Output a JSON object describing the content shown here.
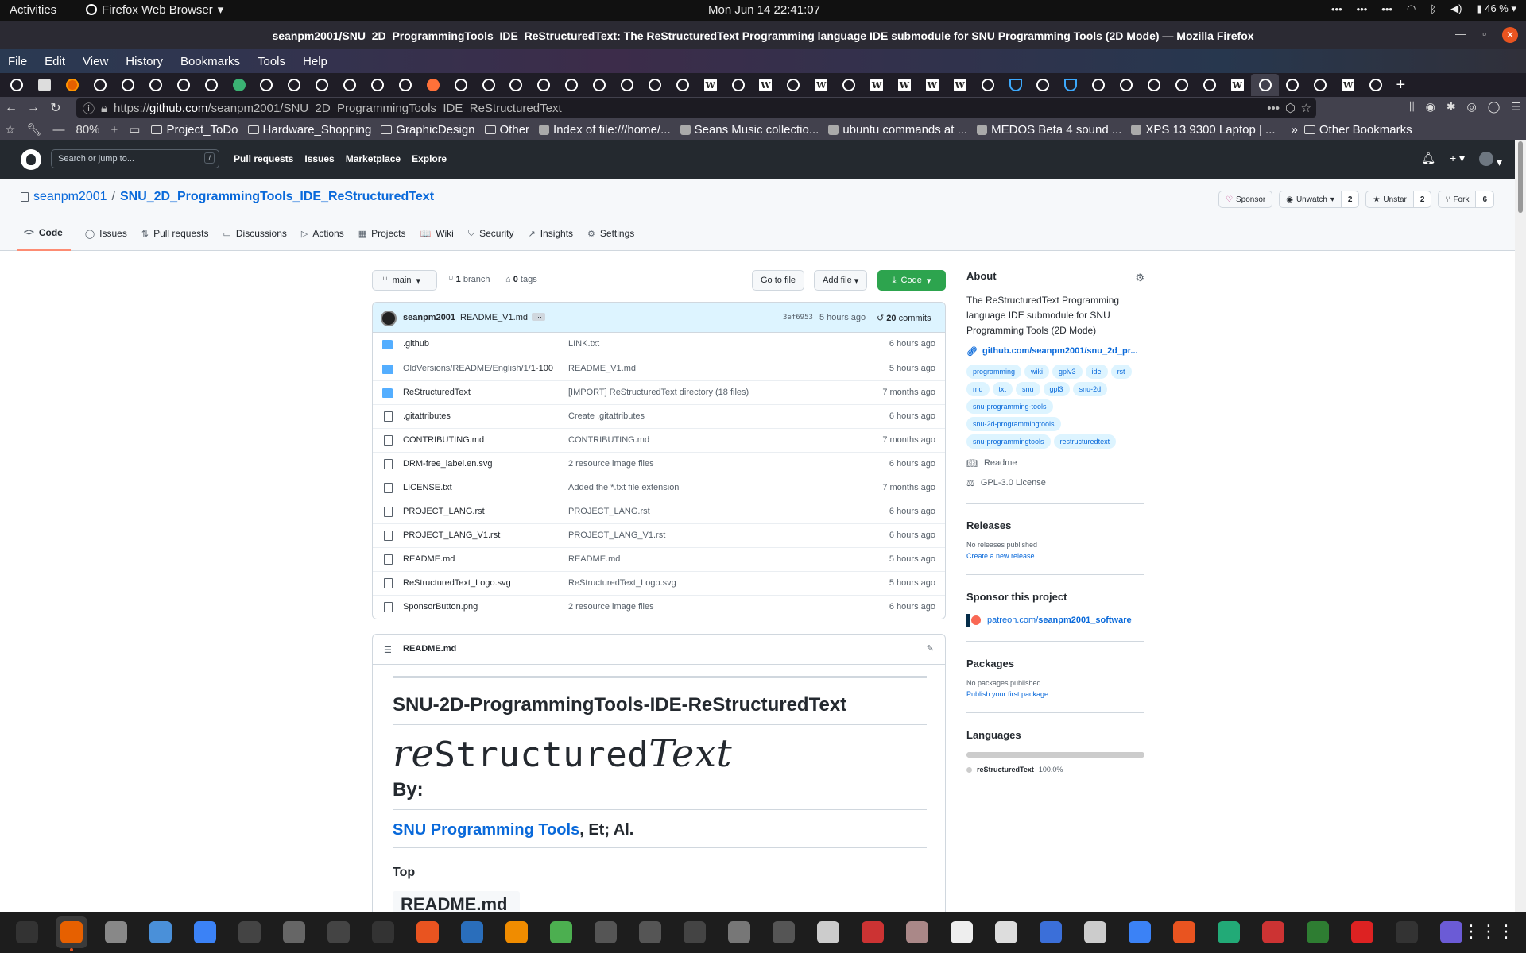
{
  "gnome": {
    "activities": "Activities",
    "app_menu": "Firefox Web Browser",
    "clock": "Mon Jun 14  22:41:07",
    "battery": "46 %"
  },
  "window": {
    "title": "seanpm2001/SNU_2D_ProgrammingTools_IDE_ReStructuredText: The ReStructuredText Programming language IDE submodule for SNU Programming Tools (2D Mode) — Mozilla Firefox"
  },
  "menubar": [
    "File",
    "Edit",
    "View",
    "History",
    "Bookmarks",
    "Tools",
    "Help"
  ],
  "tabs": [
    "gh",
    "puzzle",
    "firefox",
    "gh",
    "gh",
    "gh",
    "gh",
    "gh",
    "green",
    "gh",
    "gh",
    "gh",
    "gh",
    "gh",
    "gh",
    "orange",
    "gh",
    "gh",
    "gh",
    "gh",
    "gh",
    "gh",
    "gh",
    "gh",
    "gh",
    "w",
    "gh",
    "w",
    "gh",
    "w",
    "gh",
    "w",
    "w",
    "w",
    "w",
    "gh",
    "mw",
    "gh",
    "mw",
    "gh",
    "gh",
    "gh",
    "gh",
    "gh",
    "w",
    "gh-active",
    "gh",
    "gh",
    "w",
    "gh"
  ],
  "url": {
    "prefix": "https://",
    "host": "github.com",
    "path": "/seanpm2001/SNU_2D_ProgrammingTools_IDE_ReStructuredText"
  },
  "bookmarks": {
    "zoom": "80%",
    "items": [
      {
        "label": "Project_ToDo",
        "type": "folder"
      },
      {
        "label": "Hardware_Shopping",
        "type": "folder"
      },
      {
        "label": "GraphicDesign",
        "type": "folder"
      },
      {
        "label": "Other",
        "type": "folder"
      },
      {
        "label": "Index of file:///home/...",
        "type": "page"
      },
      {
        "label": "Seans Music collectio...",
        "type": "page"
      },
      {
        "label": "ubuntu commands at ...",
        "type": "page"
      },
      {
        "label": "MEDOS Beta 4 sound ...",
        "type": "page"
      },
      {
        "label": "XPS 13 9300 Laptop | ...",
        "type": "page"
      }
    ],
    "other": "Other Bookmarks"
  },
  "gh_header": {
    "search_placeholder": "Search or jump to...",
    "slash": "/",
    "nav": [
      "Pull requests",
      "Issues",
      "Marketplace",
      "Explore"
    ]
  },
  "repo": {
    "owner": "seanpm2001",
    "separator": "/",
    "name": "SNU_2D_ProgrammingTools_IDE_ReStructuredText",
    "sponsor": "Sponsor",
    "unwatch": "Unwatch",
    "watch_count": "2",
    "unstar": "Unstar",
    "star_count": "2",
    "fork": "Fork",
    "fork_count": "6",
    "tabs": [
      {
        "label": "Code",
        "icon": "<>"
      },
      {
        "label": "Issues",
        "icon": "◯"
      },
      {
        "label": "Pull requests",
        "icon": "⇅"
      },
      {
        "label": "Discussions",
        "icon": "▭"
      },
      {
        "label": "Actions",
        "icon": "▷"
      },
      {
        "label": "Projects",
        "icon": "▦"
      },
      {
        "label": "Wiki",
        "icon": "📖"
      },
      {
        "label": "Security",
        "icon": "⛉"
      },
      {
        "label": "Insights",
        "icon": "↗"
      },
      {
        "label": "Settings",
        "icon": "⚙"
      }
    ]
  },
  "toolbar": {
    "branch": "main",
    "branch_count": "1",
    "branch_word": "branch",
    "tag_count": "0",
    "tag_word": "tags",
    "go_to_file": "Go to file",
    "add_file": "Add file",
    "code": "Code"
  },
  "commit": {
    "author": "seanpm2001",
    "message": "README_V1.md",
    "ellipsis": "···",
    "sha": "3ef6953",
    "time": "5 hours ago",
    "count": "20",
    "count_word": "commits"
  },
  "files": [
    {
      "name": ".github",
      "dim": "",
      "type": "dir",
      "message": "LINK.txt",
      "time": "6 hours ago"
    },
    {
      "name": "1-100",
      "dim": "OldVersions/README/English/1/",
      "type": "dir",
      "message": "README_V1.md",
      "time": "5 hours ago"
    },
    {
      "name": "ReStructuredText",
      "dim": "",
      "type": "dir",
      "message": "[IMPORT] ReStructuredText directory (18 files)",
      "time": "7 months ago"
    },
    {
      "name": ".gitattributes",
      "dim": "",
      "type": "file",
      "message": "Create .gitattributes",
      "time": "6 hours ago"
    },
    {
      "name": "CONTRIBUTING.md",
      "dim": "",
      "type": "file",
      "message": "CONTRIBUTING.md",
      "time": "7 months ago"
    },
    {
      "name": "DRM-free_label.en.svg",
      "dim": "",
      "type": "file",
      "message": "2 resource image files",
      "time": "6 hours ago"
    },
    {
      "name": "LICENSE.txt",
      "dim": "",
      "type": "file",
      "message": "Added the *.txt file extension",
      "time": "7 months ago"
    },
    {
      "name": "PROJECT_LANG.rst",
      "dim": "",
      "type": "file",
      "message": "PROJECT_LANG.rst",
      "time": "6 hours ago"
    },
    {
      "name": "PROJECT_LANG_V1.rst",
      "dim": "",
      "type": "file",
      "message": "PROJECT_LANG_V1.rst",
      "time": "6 hours ago"
    },
    {
      "name": "README.md",
      "dim": "",
      "type": "file",
      "message": "README.md",
      "time": "5 hours ago"
    },
    {
      "name": "ReStructuredText_Logo.svg",
      "dim": "",
      "type": "file",
      "message": "ReStructuredText_Logo.svg",
      "time": "5 hours ago"
    },
    {
      "name": "SponsorButton.png",
      "dim": "",
      "type": "file",
      "message": "2 resource image files",
      "time": "6 hours ago"
    }
  ],
  "readme": {
    "filename": "README.md",
    "h1": "SNU-2D-ProgrammingTools-IDE-ReStructuredText",
    "logo_left": "re",
    "logo_mid": "Structured",
    "logo_right": "Text",
    "by": "By:",
    "credit_link": "SNU Programming Tools",
    "credit_rest": ", Et; Al.",
    "top": "Top",
    "cut_text": "README.md"
  },
  "about": {
    "title": "About",
    "description": "The ReStructuredText Programming language IDE submodule for SNU Programming Tools (2D Mode)",
    "website": "github.com/seanpm2001/snu_2d_pr...",
    "topics": [
      "programming",
      "wiki",
      "gplv3",
      "ide",
      "rst",
      "md",
      "txt",
      "snu",
      "gpl3",
      "snu-2d",
      "snu-programming-tools",
      "snu-2d-programmingtools",
      "snu-programmingtools",
      "restructuredtext"
    ],
    "readme": "Readme",
    "license": "GPL-3.0 License"
  },
  "releases": {
    "title": "Releases",
    "none": "No releases published",
    "create": "Create a new release"
  },
  "sponsor_project": {
    "title": "Sponsor this project",
    "link_prefix": "patreon.com/",
    "link_user": "seanpm2001_software"
  },
  "packages": {
    "title": "Packages",
    "none": "No packages published",
    "publish": "Publish your first package"
  },
  "languages": {
    "title": "Languages",
    "name": "reStructuredText",
    "percent": "100.0%",
    "share": 1.0
  },
  "dock": [
    "monitor",
    "firefox",
    "files",
    "editor",
    "help",
    "puzzle",
    "settings",
    "waveform",
    "terminal",
    "appstore",
    "calc-doc",
    "vlc",
    "calendar-28",
    "calculator",
    "search",
    "inkscape",
    "disc",
    "shell",
    "glasses",
    "ebook",
    "archive",
    "char-a",
    "char-b",
    "check",
    "vim",
    "window",
    "update",
    "pycharm",
    "mario",
    "sheet",
    "alert",
    "music",
    "camera"
  ]
}
